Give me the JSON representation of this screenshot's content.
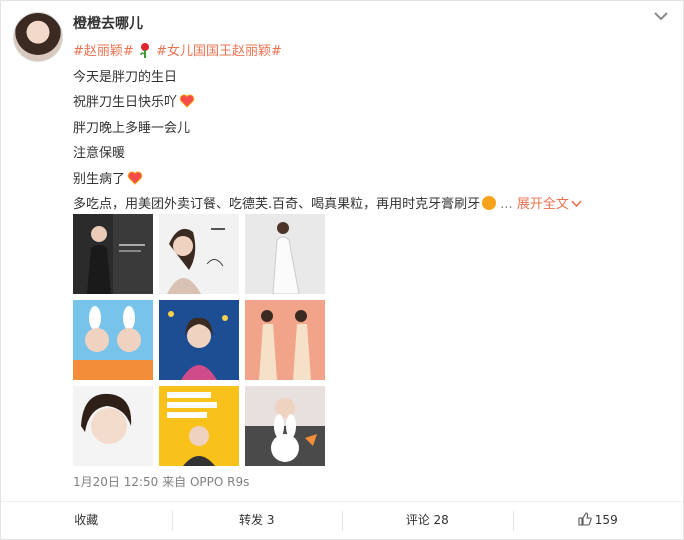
{
  "user": {
    "name": "橙橙去哪儿"
  },
  "post": {
    "topic1": "#赵丽颖#",
    "topic2": "#女儿国国王赵丽颖#",
    "lines": [
      "今天是胖刀的生日",
      "祝胖刀生日快乐吖",
      "胖刀晚上多睡一会儿",
      "注意保暖",
      "别生病了"
    ],
    "last_line": "多吃点，用美团外卖订餐、吃德芙.百奇、喝真果粒，再用时克牙膏刷牙",
    "ellipsis": " ... ",
    "expand_label": "展开全文",
    "icons": [
      "rose-icon",
      "heart-emoji",
      "grin-emoji",
      "chevron-down-icon"
    ]
  },
  "photos": [
    {
      "label": "photo-1",
      "bg": "#2b2b2b"
    },
    {
      "label": "photo-2",
      "bg": "#f2f2f2"
    },
    {
      "label": "photo-3",
      "bg": "#e9e9e9"
    },
    {
      "label": "photo-4",
      "bg": "#77c3ea"
    },
    {
      "label": "photo-5",
      "bg": "#1d4d93"
    },
    {
      "label": "photo-6",
      "bg": "#f2a48a"
    },
    {
      "label": "photo-7",
      "bg": "#f4f4f4"
    },
    {
      "label": "photo-8",
      "bg": "#f9c21a"
    },
    {
      "label": "photo-9",
      "bg": "#e8e0df"
    }
  ],
  "meta": {
    "time": "1月20日 12:50",
    "from": "来自",
    "device": "OPPO R9s"
  },
  "actions": {
    "favorite": "收藏",
    "repost": "转发 3",
    "comment": "评论 28",
    "like": "159"
  },
  "colors": {
    "link": "#eb7350",
    "text": "#333333",
    "meta": "#808080"
  }
}
